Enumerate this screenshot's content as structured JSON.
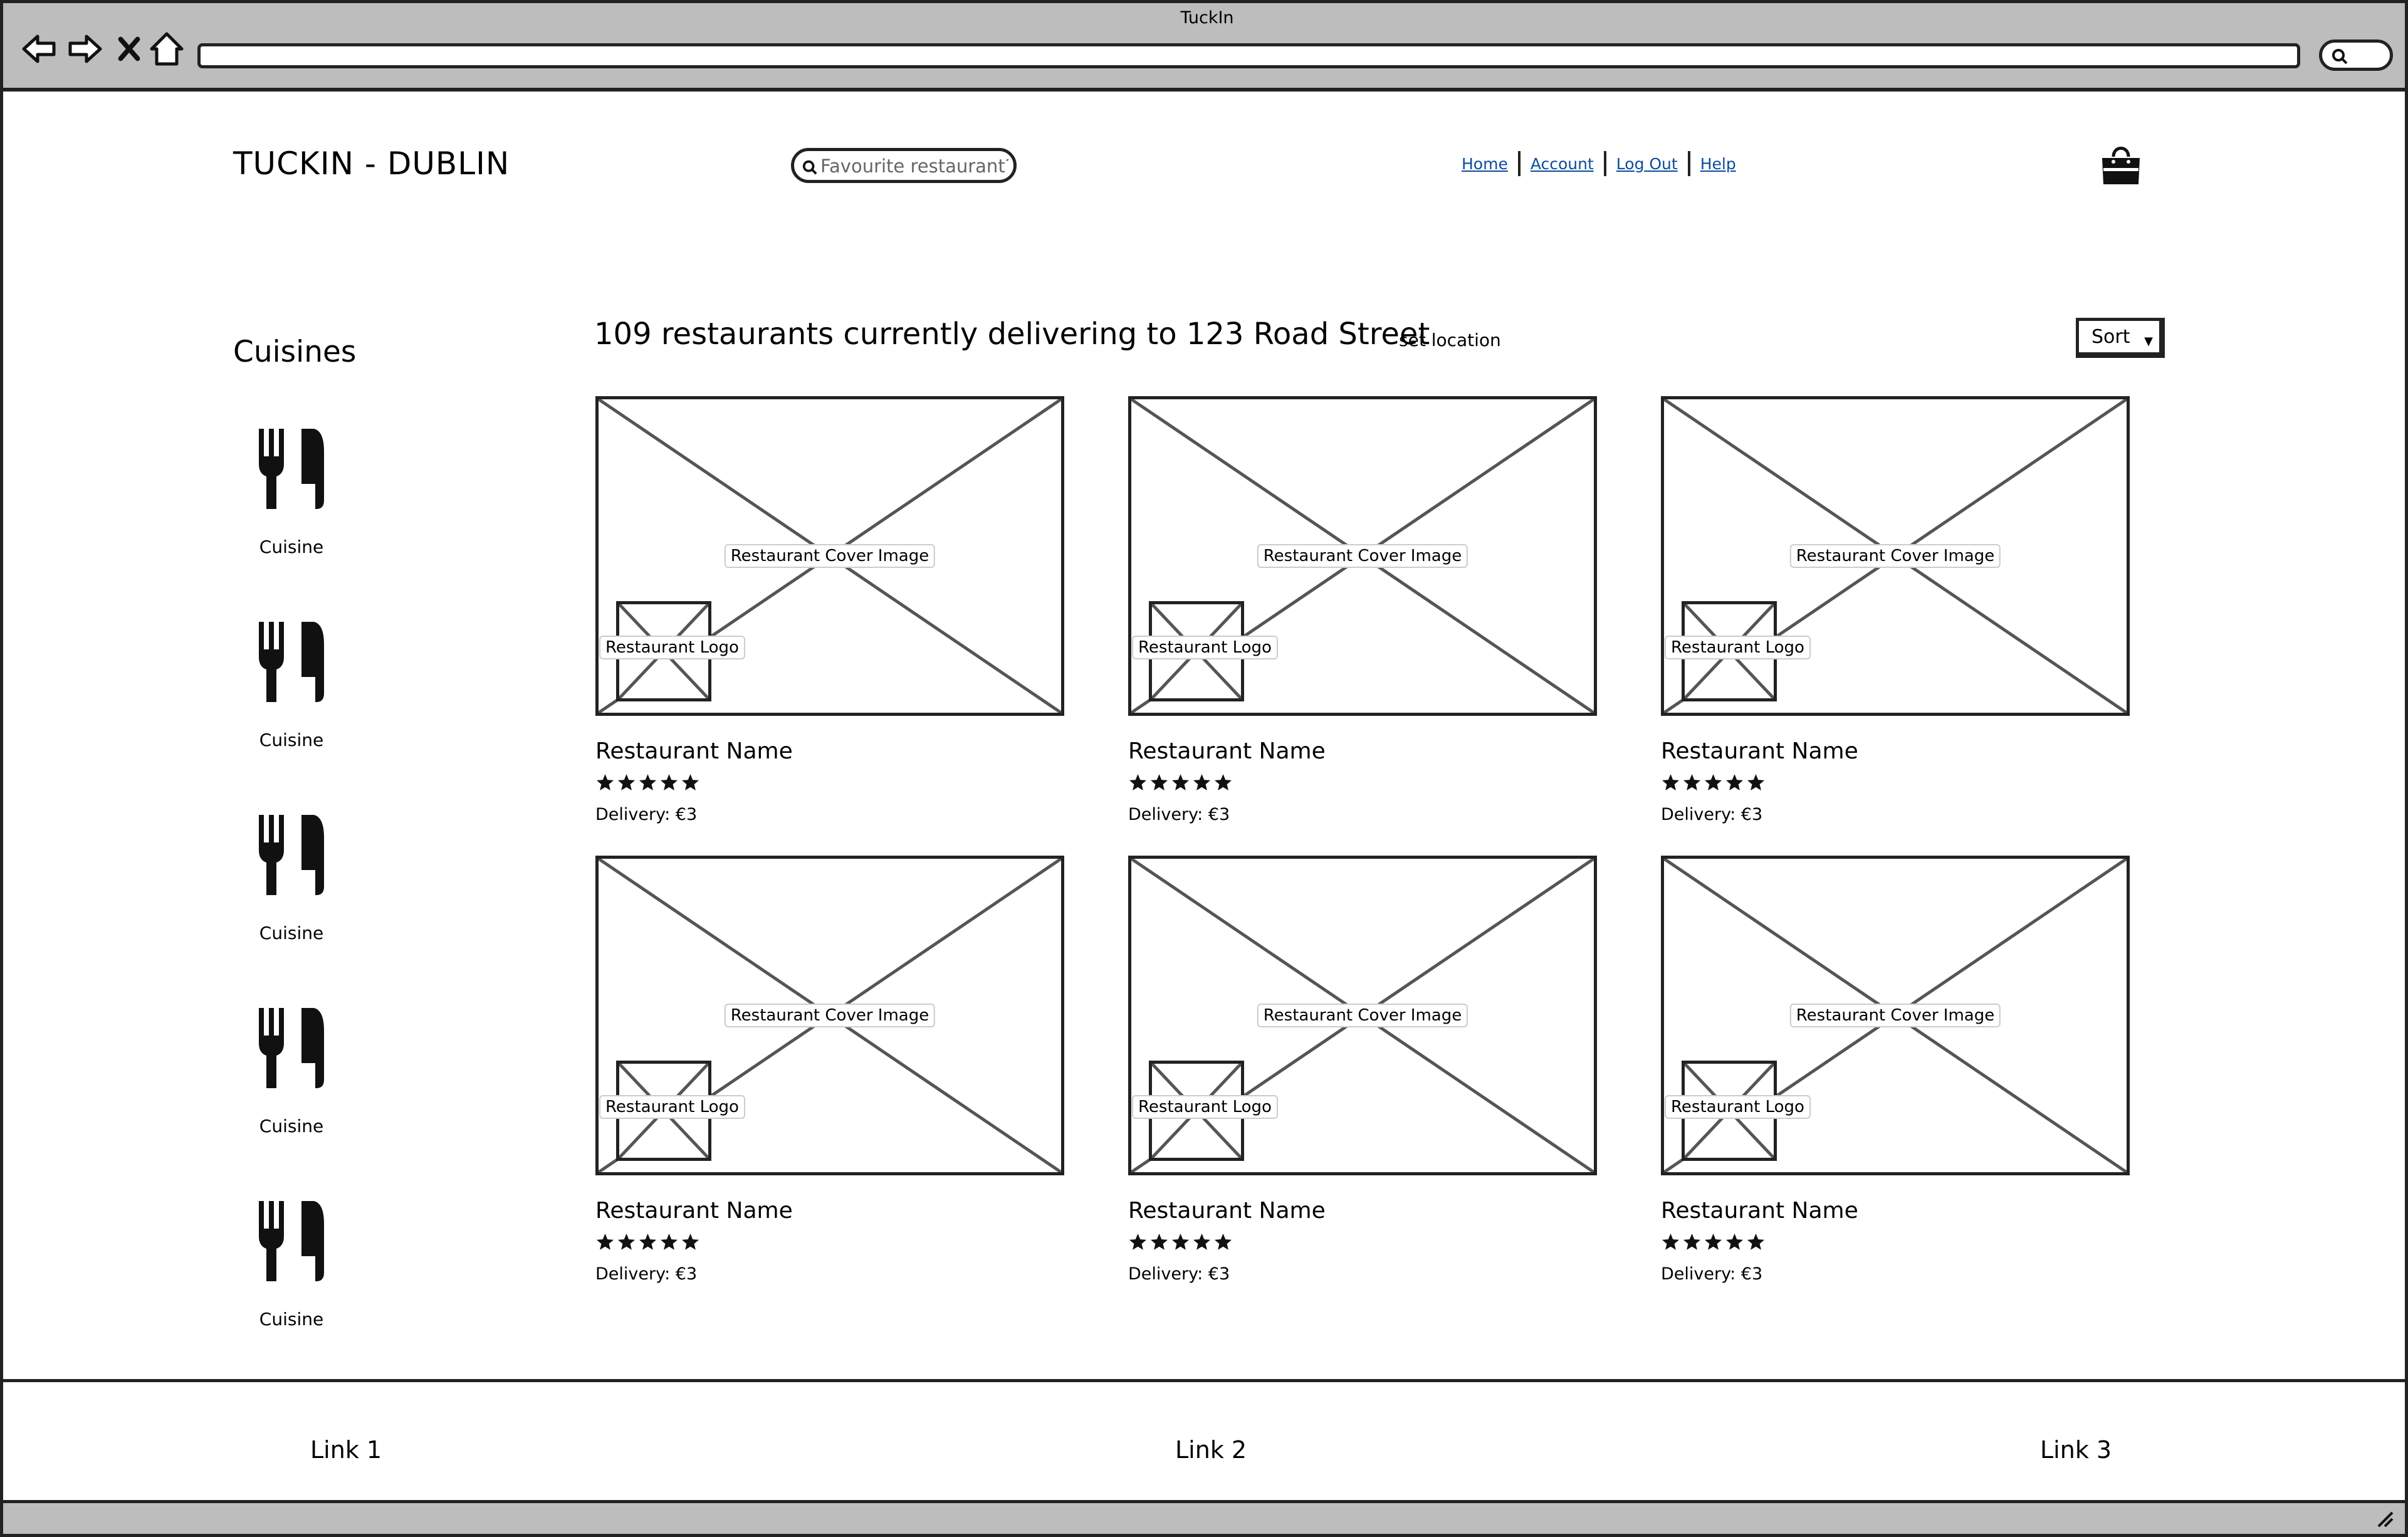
{
  "window": {
    "title": "TuckIn"
  },
  "header": {
    "brand": "TUCKIN - DUBLIN",
    "search_placeholder": "Favourite restaurant?",
    "nav": [
      "Home",
      "Account",
      "Log Out",
      "Help"
    ]
  },
  "sidebar": {
    "title": "Cuisines",
    "items": [
      "Cuisine",
      "Cuisine",
      "Cuisine",
      "Cuisine",
      "Cuisine"
    ]
  },
  "results": {
    "heading": "109 restaurants currently delivering to 123 Road Street",
    "set_location": "set location",
    "sort_label": "Sort"
  },
  "restaurants": [
    {
      "cover_label": "Restaurant Cover Image",
      "logo_label": "Restaurant Logo",
      "name": "Restaurant Name",
      "rating": 5,
      "delivery": "Delivery: €3"
    },
    {
      "cover_label": "Restaurant Cover Image",
      "logo_label": "Restaurant Logo",
      "name": "Restaurant Name",
      "rating": 5,
      "delivery": "Delivery: €3"
    },
    {
      "cover_label": "Restaurant Cover Image",
      "logo_label": "Restaurant Logo",
      "name": "Restaurant Name",
      "rating": 5,
      "delivery": "Delivery: €3"
    },
    {
      "cover_label": "Restaurant Cover Image",
      "logo_label": "Restaurant Logo",
      "name": "Restaurant Name",
      "rating": 5,
      "delivery": "Delivery: €3"
    },
    {
      "cover_label": "Restaurant Cover Image",
      "logo_label": "Restaurant Logo",
      "name": "Restaurant Name",
      "rating": 5,
      "delivery": "Delivery: €3"
    },
    {
      "cover_label": "Restaurant Cover Image",
      "logo_label": "Restaurant Logo",
      "name": "Restaurant Name",
      "rating": 5,
      "delivery": "Delivery: €3"
    }
  ],
  "footer": {
    "links": [
      "Link 1",
      "Link 2",
      "Link 3"
    ]
  },
  "icons": {
    "browser": [
      "back-arrow-icon",
      "forward-arrow-icon",
      "close-x-icon",
      "home-icon",
      "search-icon"
    ],
    "cart": "shopping-bag-icon",
    "cuisine": "fork-knife-icon",
    "rating": "star-icon"
  },
  "colors": {
    "chrome": "#bdbdbd",
    "link": "#0b4c9c",
    "outline": "#222222"
  }
}
